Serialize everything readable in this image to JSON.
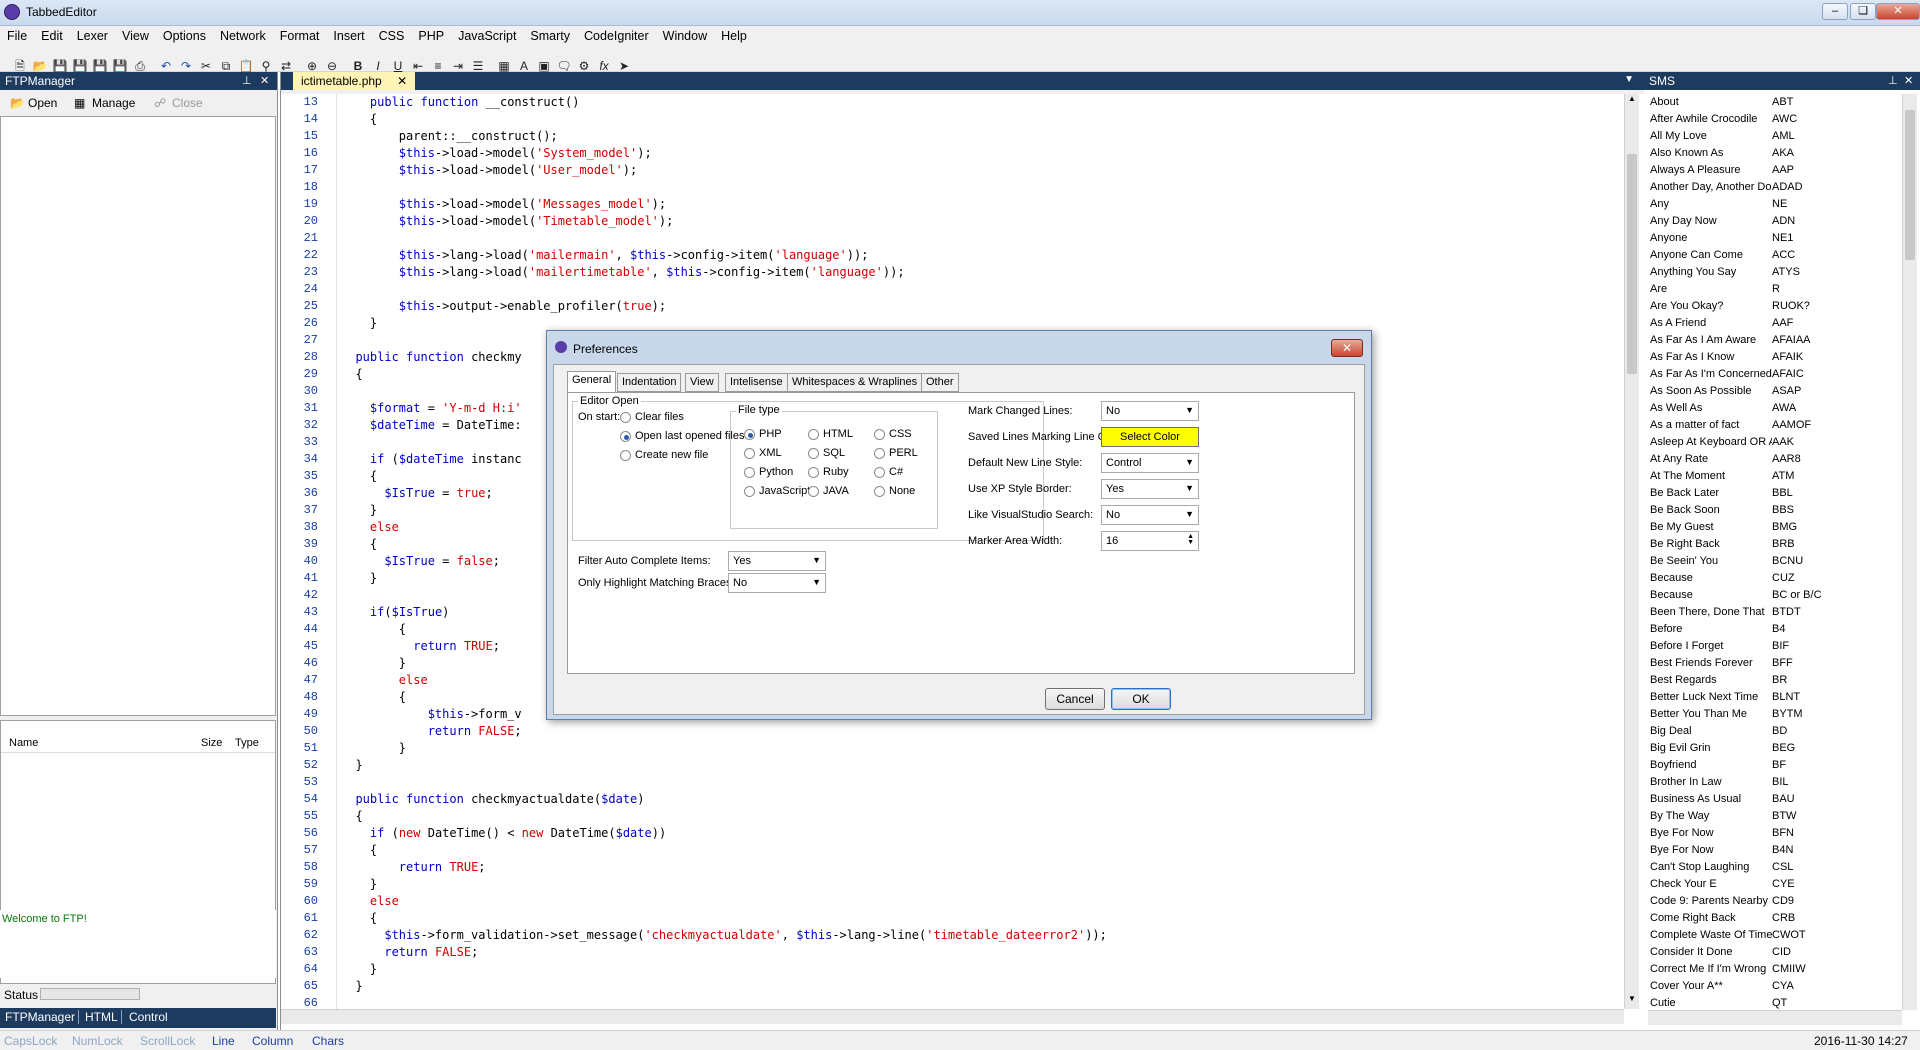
{
  "app": {
    "title": "TabbedEditor"
  },
  "menu": [
    "File",
    "Edit",
    "Lexer",
    "View",
    "Options",
    "Network",
    "Format",
    "Insert",
    "CSS",
    "PHP",
    "JavaScript",
    "Smarty",
    "CodeIgniter",
    "Window",
    "Help"
  ],
  "ftp": {
    "title": "FTPManager",
    "open_label": "Open",
    "manage_label": "Manage",
    "close_label": "Close",
    "columns": [
      "Name",
      "Size",
      "Type"
    ],
    "log": "Welcome to FTP!",
    "status_label": "Status",
    "bottom_tabs": [
      "FTPManager",
      "HTML",
      "Control"
    ]
  },
  "editor": {
    "tab": "ictimetable.php",
    "lines": [
      {
        "n": "13",
        "t": "    public function __construct()"
      },
      {
        "n": "14",
        "t": "    {"
      },
      {
        "n": "15",
        "t": "        parent::__construct();"
      },
      {
        "n": "16",
        "t": "        $this->load->model('System_model');"
      },
      {
        "n": "17",
        "t": "        $this->load->model('User_model');"
      },
      {
        "n": "18",
        "t": ""
      },
      {
        "n": "19",
        "t": "        $this->load->model('Messages_model');"
      },
      {
        "n": "20",
        "t": "        $this->load->model('Timetable_model');"
      },
      {
        "n": "21",
        "t": ""
      },
      {
        "n": "22",
        "t": "        $this->lang->load('mailermain', $this->config->item('language'));"
      },
      {
        "n": "23",
        "t": "        $this->lang->load('mailertimetable', $this->config->item('language'));"
      },
      {
        "n": "24",
        "t": ""
      },
      {
        "n": "25",
        "t": "        $this->output->enable_profiler(true);"
      },
      {
        "n": "26",
        "t": "    }"
      },
      {
        "n": "27",
        "t": ""
      },
      {
        "n": "28",
        "t": "  public function checkmy"
      },
      {
        "n": "29",
        "t": "  {"
      },
      {
        "n": "30",
        "t": ""
      },
      {
        "n": "31",
        "t": "    $format = 'Y-m-d H:i'"
      },
      {
        "n": "32",
        "t": "    $dateTime = DateTime:"
      },
      {
        "n": "33",
        "t": ""
      },
      {
        "n": "34",
        "t": "    if ($dateTime instanc"
      },
      {
        "n": "35",
        "t": "    {"
      },
      {
        "n": "36",
        "t": "      $IsTrue = true;"
      },
      {
        "n": "37",
        "t": "    }"
      },
      {
        "n": "38",
        "t": "    else"
      },
      {
        "n": "39",
        "t": "    {"
      },
      {
        "n": "40",
        "t": "      $IsTrue = false;"
      },
      {
        "n": "41",
        "t": "    }"
      },
      {
        "n": "42",
        "t": ""
      },
      {
        "n": "43",
        "t": "    if($IsTrue)"
      },
      {
        "n": "44",
        "t": "        {"
      },
      {
        "n": "45",
        "t": "          return TRUE;"
      },
      {
        "n": "46",
        "t": "        }"
      },
      {
        "n": "47",
        "t": "        else"
      },
      {
        "n": "48",
        "t": "        {"
      },
      {
        "n": "49",
        "t": "            $this->form_v"
      },
      {
        "n": "50",
        "t": "            return FALSE;"
      },
      {
        "n": "51",
        "t": "        }"
      },
      {
        "n": "52",
        "t": "  }"
      },
      {
        "n": "53",
        "t": ""
      },
      {
        "n": "54",
        "t": "  public function checkmyactualdate($date)"
      },
      {
        "n": "55",
        "t": "  {"
      },
      {
        "n": "56",
        "t": "    if (new DateTime() < new DateTime($date))"
      },
      {
        "n": "57",
        "t": "    {"
      },
      {
        "n": "58",
        "t": "        return TRUE;"
      },
      {
        "n": "59",
        "t": "    }"
      },
      {
        "n": "60",
        "t": "    else"
      },
      {
        "n": "61",
        "t": "    {"
      },
      {
        "n": "62",
        "t": "      $this->form_validation->set_message('checkmyactualdate', $this->lang->line('timetable_dateerror2'));"
      },
      {
        "n": "63",
        "t": "      return FALSE;"
      },
      {
        "n": "64",
        "t": "    }"
      },
      {
        "n": "65",
        "t": "  }"
      },
      {
        "n": "66",
        "t": ""
      }
    ]
  },
  "dialog": {
    "title": "Preferences",
    "tabs": [
      "General",
      "Indentation",
      "View",
      "Intelisense",
      "Whitespaces & Wraplines",
      "Other"
    ],
    "editor_open_label": "Editor Open",
    "on_start_label": "On start:",
    "on_start_options": [
      "Clear files",
      "Open last opened files",
      "Create new file"
    ],
    "file_type_label": "File type",
    "file_types": [
      "PHP",
      "HTML",
      "CSS",
      "XML",
      "SQL",
      "PERL",
      "Python",
      "Ruby",
      "C#",
      "JavaScript",
      "JAVA",
      "None"
    ],
    "filter_label": "Filter Auto Complete Items:",
    "filter_value": "Yes",
    "braces_label": "Only Highlight Matching Braces:",
    "braces_value": "No",
    "mark_changed_label": "Mark Changed Lines:",
    "mark_changed_value": "No",
    "saved_color_label": "Saved Lines Marking Line Color:",
    "select_color_label": "Select Color",
    "select_color_hex": "#ffff00",
    "line_style_label": "Default New Line Style:",
    "line_style_value": "Control",
    "xp_border_label": "Use XP Style Border:",
    "xp_border_value": "Yes",
    "vs_search_label": "Like VisualStudio Search:",
    "vs_search_value": "No",
    "marker_width_label": "Marker Area Width:",
    "marker_width_value": "16",
    "cancel_label": "Cancel",
    "ok_label": "OK"
  },
  "sms": {
    "title": "SMS",
    "items": [
      [
        "About",
        "ABT"
      ],
      [
        "After Awhile Crocodile",
        "AWC"
      ],
      [
        "All My Love",
        "AML"
      ],
      [
        "Also Known As",
        "AKA"
      ],
      [
        "Always A Pleasure",
        "AAP"
      ],
      [
        "Another Day, Another Dollar",
        "ADAD"
      ],
      [
        "Any",
        "NE"
      ],
      [
        "Any Day Now",
        "ADN"
      ],
      [
        "Anyone",
        "NE1"
      ],
      [
        "Anyone Can Come",
        "ACC"
      ],
      [
        "Anything You Say",
        "ATYS"
      ],
      [
        "Are",
        "R"
      ],
      [
        "Are You Okay?",
        "RUOK?"
      ],
      [
        "As A Friend",
        "AAF"
      ],
      [
        "As Far As I Am Aware",
        "AFAIAA"
      ],
      [
        "As Far As I Know",
        "AFAIK"
      ],
      [
        "As Far As I'm Concerned",
        "AFAIC"
      ],
      [
        "As Soon As Possible",
        "ASAP"
      ],
      [
        "As Well As",
        "AWA"
      ],
      [
        "As a matter of fact",
        "AAMOF"
      ],
      [
        "Asleep At Keyboard OR Aliv...",
        "AAK"
      ],
      [
        "At Any Rate",
        "AAR8"
      ],
      [
        "At The Moment",
        "ATM"
      ],
      [
        "Be Back Later",
        "BBL"
      ],
      [
        "Be Back Soon",
        "BBS"
      ],
      [
        "Be My Guest",
        "BMG"
      ],
      [
        "Be Right Back",
        "BRB"
      ],
      [
        "Be Seein' You",
        "BCNU"
      ],
      [
        "Because",
        "CUZ"
      ],
      [
        "Because",
        "BC or B/C"
      ],
      [
        "Been There, Done That",
        "BTDT"
      ],
      [
        "Before",
        "B4"
      ],
      [
        "Before I Forget",
        "BIF"
      ],
      [
        "Best Friends Forever",
        "BFF"
      ],
      [
        "Best Regards",
        "BR"
      ],
      [
        "Better Luck Next Time",
        "BLNT"
      ],
      [
        "Better You Than Me",
        "BYTM"
      ],
      [
        "Big Deal",
        "BD"
      ],
      [
        "Big Evil Grin",
        "BEG"
      ],
      [
        "Boyfriend",
        "BF"
      ],
      [
        "Brother In Law",
        "BIL"
      ],
      [
        "Business As Usual",
        "BAU"
      ],
      [
        "By The Way",
        "BTW"
      ],
      [
        "Bye For Now",
        "BFN"
      ],
      [
        "Bye For Now",
        "B4N"
      ],
      [
        "Can't Stop Laughing",
        "CSL"
      ],
      [
        "Check Your E",
        "CYE"
      ],
      [
        "Code 9: Parents Nearby",
        "CD9"
      ],
      [
        "Come Right Back",
        "CRB"
      ],
      [
        "Complete Waste Of Time",
        "CWOT"
      ],
      [
        "Consider It Done",
        "CID"
      ],
      [
        "Correct Me If I'm Wrong",
        "CMIIW"
      ],
      [
        "Cover Your A**",
        "CYA"
      ],
      [
        "Cutie",
        "QT"
      ]
    ]
  },
  "status": {
    "capslock": "CapsLock",
    "numlock": "NumLock",
    "scrolllock": "ScrollLock",
    "line": "Line",
    "column": "Column",
    "chars": "Chars",
    "datetime": "2016-11-30 14:27"
  }
}
